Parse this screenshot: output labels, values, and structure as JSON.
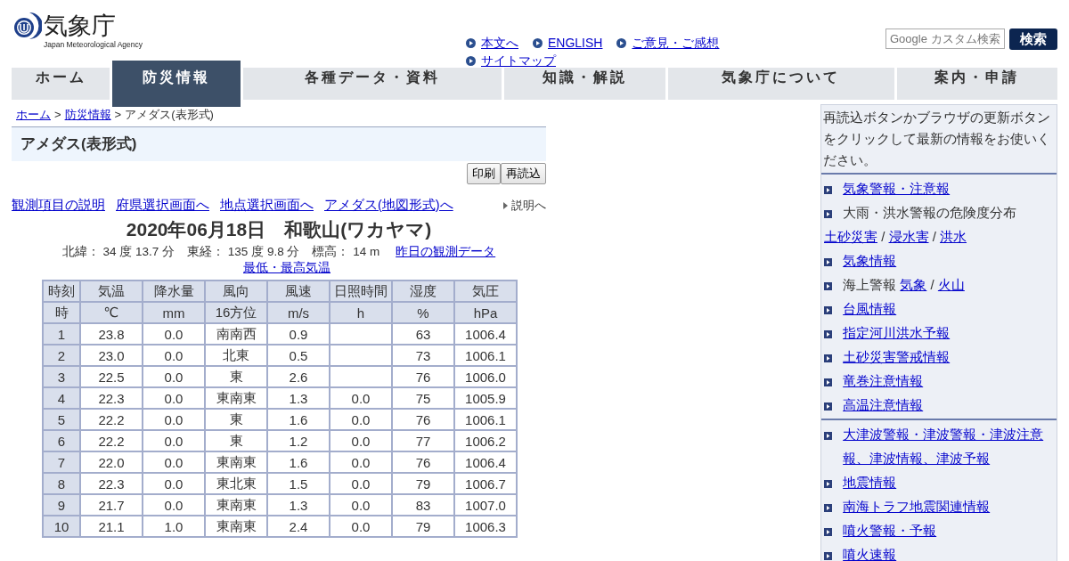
{
  "logo": {
    "title": "気象庁",
    "subtitle": "Japan Meteorological Agency"
  },
  "top_links": [
    {
      "label": "本文へ"
    },
    {
      "label": "ENGLISH"
    },
    {
      "label": "ご意見・ご感想"
    },
    {
      "label": "サイトマップ"
    }
  ],
  "search": {
    "placeholder": "Google カスタム検索",
    "button": "検索"
  },
  "nav": [
    {
      "label": "ホーム",
      "selected": false
    },
    {
      "label": "防災情報",
      "selected": true
    },
    {
      "label": "各種データ・資料",
      "selected": false
    },
    {
      "label": "知識・解説",
      "selected": false
    },
    {
      "label": "気象庁について",
      "selected": false
    },
    {
      "label": "案内・申請",
      "selected": false
    }
  ],
  "breadcrumb": [
    {
      "label": "ホーム",
      "kind": "link"
    },
    {
      "label": ">",
      "kind": "separator"
    },
    {
      "label": "防災情報",
      "kind": "link"
    },
    {
      "label": ">",
      "kind": "separator"
    },
    {
      "label": "アメダス(表形式)",
      "kind": "text"
    }
  ],
  "page_title": "アメダス(表形式)",
  "buttons": [
    "印刷",
    "再読込"
  ],
  "sub_links": [
    "観測項目の説明",
    "府県選択画面へ",
    "地点選択画面へ",
    "アメダス(地図形式)へ"
  ],
  "help_link": "説明へ",
  "heading": "2020年06月18日　和歌山(ワカヤマ)",
  "location": "北緯：  34 度 13.7 分　東経：  135 度 9.8 分　標高：  14 m",
  "location_links": [
    "昨日の観測データ",
    "最低・最高気温"
  ],
  "table": {
    "columns": [
      {
        "name": "時刻",
        "unit": "時"
      },
      {
        "name": "気温",
        "unit": "℃"
      },
      {
        "name": "降水量",
        "unit": "mm"
      },
      {
        "name": "風向",
        "unit": "16方位"
      },
      {
        "name": "風速",
        "unit": "m/s"
      },
      {
        "name": "日照時間",
        "unit": "h"
      },
      {
        "name": "湿度",
        "unit": "%"
      },
      {
        "name": "気圧",
        "unit": "hPa"
      }
    ],
    "rows": [
      [
        "1",
        "23.8",
        "0.0",
        "南南西",
        "0.9",
        "",
        "63",
        "1006.4"
      ],
      [
        "2",
        "23.0",
        "0.0",
        "北東",
        "0.5",
        "",
        "73",
        "1006.1"
      ],
      [
        "3",
        "22.5",
        "0.0",
        "東",
        "2.6",
        "",
        "76",
        "1006.0"
      ],
      [
        "4",
        "22.3",
        "0.0",
        "東南東",
        "1.3",
        "0.0",
        "75",
        "1005.9"
      ],
      [
        "5",
        "22.2",
        "0.0",
        "東",
        "1.6",
        "0.0",
        "76",
        "1006.1"
      ],
      [
        "6",
        "22.2",
        "0.0",
        "東",
        "1.2",
        "0.0",
        "77",
        "1006.2"
      ],
      [
        "7",
        "22.0",
        "0.0",
        "東南東",
        "1.6",
        "0.0",
        "76",
        "1006.4"
      ],
      [
        "8",
        "22.3",
        "0.0",
        "東北東",
        "1.5",
        "0.0",
        "79",
        "1006.7"
      ],
      [
        "9",
        "21.7",
        "0.0",
        "東南東",
        "1.3",
        "0.0",
        "83",
        "1007.0"
      ],
      [
        "10",
        "21.1",
        "1.0",
        "東南東",
        "2.4",
        "0.0",
        "79",
        "1006.3"
      ]
    ]
  },
  "sidebar": {
    "notice": "再読込ボタンかブラウザの更新ボタンをクリックして最新の情報をお使いください。",
    "sections": [
      [
        {
          "segments": [
            {
              "text": "気象警報・注意報",
              "kind": "link"
            }
          ]
        },
        {
          "segments": [
            {
              "text": "大雨・洪水警報の危険度分布",
              "kind": "text"
            },
            {
              "text": "土砂災害",
              "kind": "link"
            },
            {
              "text": "/",
              "kind": "text"
            },
            {
              "text": "浸水害",
              "kind": "link"
            },
            {
              "text": "/",
              "kind": "text"
            },
            {
              "text": "洪水",
              "kind": "link"
            }
          ]
        },
        {
          "segments": [
            {
              "text": "気象情報",
              "kind": "link"
            }
          ]
        },
        {
          "segments": [
            {
              "text": "海上警報",
              "kind": "text"
            },
            {
              "text": "気象",
              "kind": "link"
            },
            {
              "text": "/",
              "kind": "text"
            },
            {
              "text": "火山",
              "kind": "link"
            }
          ]
        },
        {
          "segments": [
            {
              "text": "台風情報",
              "kind": "link"
            }
          ]
        },
        {
          "segments": [
            {
              "text": "指定河川洪水予報",
              "kind": "link"
            }
          ]
        },
        {
          "segments": [
            {
              "text": "土砂災害警戒情報",
              "kind": "link"
            }
          ]
        },
        {
          "segments": [
            {
              "text": "竜巻注意情報",
              "kind": "link"
            }
          ]
        },
        {
          "segments": [
            {
              "text": "高温注意情報",
              "kind": "link"
            }
          ]
        }
      ],
      [
        {
          "segments": [
            {
              "text": "大津波警報・津波警報・津波注意報、津波情報、津波予報",
              "kind": "link"
            }
          ]
        },
        {
          "segments": [
            {
              "text": "地震情報",
              "kind": "link"
            }
          ]
        },
        {
          "segments": [
            {
              "text": "南海トラフ地震関連情報",
              "kind": "link"
            }
          ]
        },
        {
          "segments": [
            {
              "text": "噴火警報・予報",
              "kind": "link"
            }
          ]
        },
        {
          "segments": [
            {
              "text": "噴火速報",
              "kind": "link"
            }
          ]
        }
      ]
    ]
  }
}
